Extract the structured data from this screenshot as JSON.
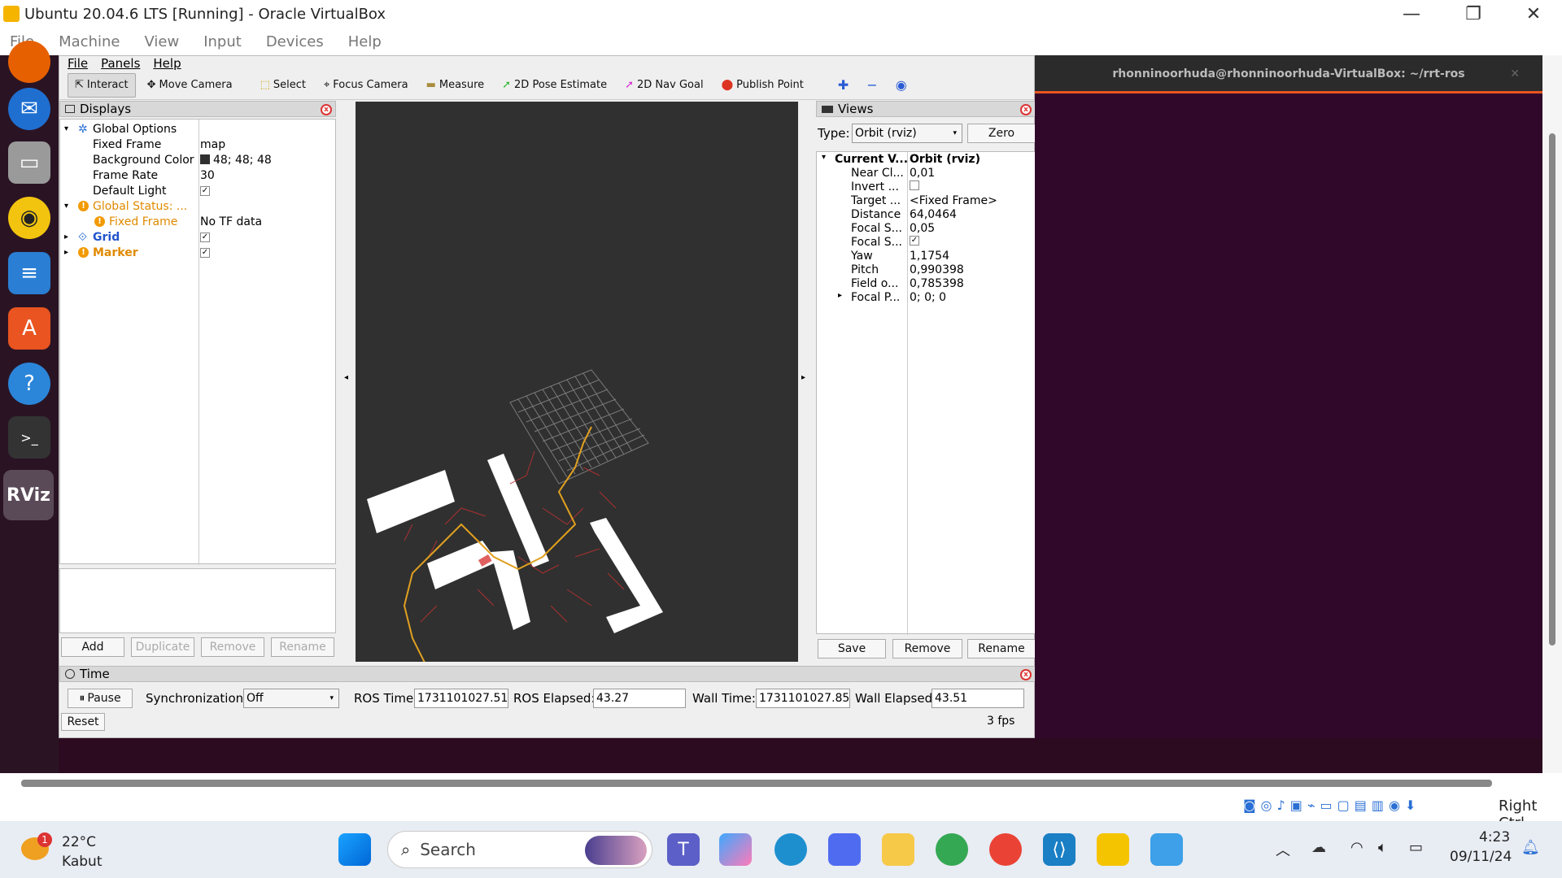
{
  "vbox": {
    "title": "Ubuntu 20.04.6 LTS [Running] - Oracle VirtualBox",
    "menu": [
      "File",
      "Machine",
      "View",
      "Input",
      "Devices",
      "Help"
    ],
    "host_key": "Right Ctrl"
  },
  "rviz": {
    "menu": [
      "File",
      "Panels",
      "Help"
    ],
    "tools": [
      "Interact",
      "Move Camera",
      "Select",
      "Focus Camera",
      "Measure",
      "2D Pose Estimate",
      "2D Nav Goal",
      "Publish Point"
    ],
    "displays": {
      "title": "Displays",
      "rows": [
        {
          "name": "Global Options",
          "value": ""
        },
        {
          "name": "Fixed Frame",
          "value": "map"
        },
        {
          "name": "Background Color",
          "value": "48; 48; 48"
        },
        {
          "name": "Frame Rate",
          "value": "30"
        },
        {
          "name": "Default Light",
          "value": "✓"
        },
        {
          "name": "Global Status: ...",
          "value": ""
        },
        {
          "name": "Fixed Frame",
          "value": "No TF data"
        },
        {
          "name": "Grid",
          "value": "✓"
        },
        {
          "name": "Marker",
          "value": "✓"
        }
      ],
      "buttons": [
        "Add",
        "Duplicate",
        "Remove",
        "Rename"
      ]
    },
    "views": {
      "title": "Views",
      "type_label": "Type:",
      "type_value": "Orbit (rviz)",
      "zero": "Zero",
      "header_name": "Current V...",
      "header_value": "Orbit (rviz)",
      "rows": [
        {
          "name": "Near Cl...",
          "value": "0,01"
        },
        {
          "name": "Invert ...",
          "value": ""
        },
        {
          "name": "Target ...",
          "value": "<Fixed Frame>"
        },
        {
          "name": "Distance",
          "value": "64,0464"
        },
        {
          "name": "Focal S...",
          "value": "0,05"
        },
        {
          "name": "Focal S...",
          "value": "✓"
        },
        {
          "name": "Yaw",
          "value": "1,1754"
        },
        {
          "name": "Pitch",
          "value": "0,990398"
        },
        {
          "name": "Field o...",
          "value": "0,785398"
        },
        {
          "name": "Focal P...",
          "value": "0; 0; 0"
        }
      ],
      "buttons": [
        "Save",
        "Remove",
        "Rename"
      ]
    },
    "time": {
      "title": "Time",
      "pause": "Pause",
      "sync_label": "Synchronization:",
      "sync_value": "Off",
      "ros_time_label": "ROS Time:",
      "ros_time": "1731101027.51",
      "ros_elapsed_label": "ROS Elapsed:",
      "ros_elapsed": "43.27",
      "wall_time_label": "Wall Time:",
      "wall_time": "1731101027.85",
      "wall_elapsed_label": "Wall Elapsed:",
      "wall_elapsed": "43.51",
      "reset": "Reset",
      "fps": "3 fps"
    }
  },
  "terminal": {
    "title": "rhonninoorhuda@rhonninoorhuda-VirtualBox: ~/rrt-ros"
  },
  "taskbar": {
    "weather_temp": "22°C",
    "weather_desc": "Kabut",
    "weather_badge": "1",
    "search": "Search",
    "time": "4:23",
    "date": "09/11/24"
  }
}
